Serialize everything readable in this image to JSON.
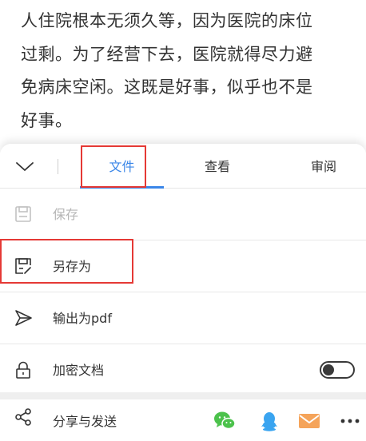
{
  "document": {
    "lines": [
      "人住院根本无须久等，因为医院的床位",
      "过剩。为了经营下去，医院就得尽力避",
      "免病床空闲。这既是好事，似乎也不是",
      "好事。"
    ]
  },
  "tabs": {
    "file": "文件",
    "view": "查看",
    "review": "审阅"
  },
  "menu": {
    "save": "保存",
    "save_as": "另存为",
    "export_pdf": "输出为pdf",
    "encrypt": "加密文档",
    "share": "分享与发送"
  },
  "encrypt_toggle": {
    "on": false
  },
  "colors": {
    "accent": "#3a86e8",
    "highlight": "#e53935",
    "wechat": "#4cc24c",
    "qq": "#3aa4f0",
    "mail": "#f5a45a"
  },
  "icons": {
    "collapse": "chevron-down-icon",
    "save": "save-icon",
    "save_as": "save-as-icon",
    "export_pdf": "send-icon",
    "encrypt": "lock-icon",
    "share": "share-icon",
    "wechat": "wechat-icon",
    "qq": "qq-icon",
    "mail": "mail-icon",
    "more": "more-icon"
  }
}
